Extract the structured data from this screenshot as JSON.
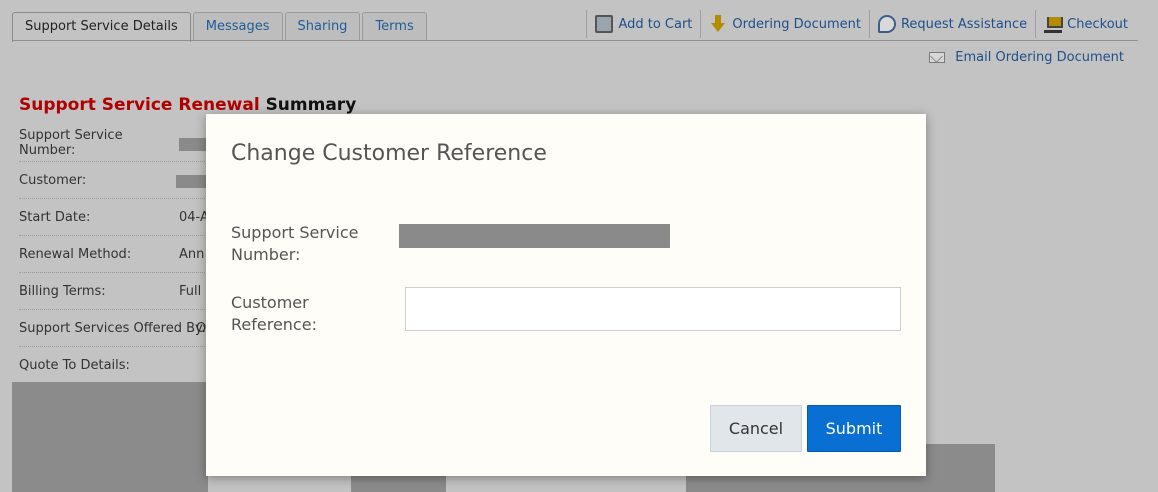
{
  "tabs": [
    {
      "label": "Support Service Details",
      "active": true
    },
    {
      "label": "Messages",
      "active": false
    },
    {
      "label": "Sharing",
      "active": false
    },
    {
      "label": "Terms",
      "active": false
    }
  ],
  "toolbar": {
    "add_to_cart": "Add to Cart",
    "ordering_document": "Ordering Document",
    "request_assistance": "Request Assistance",
    "checkout": "Checkout",
    "email_ordering_document": "Email Ordering Document"
  },
  "summary": {
    "title_red": "Support Service Renewal",
    "title_black": "Summary",
    "rows": [
      {
        "label": "Support Service Number:",
        "value": ""
      },
      {
        "label": "Customer:",
        "value": ""
      },
      {
        "label": "Start Date:",
        "value": "04-A"
      },
      {
        "label": "Renewal Method:",
        "value": "Ann"
      },
      {
        "label": "Billing Terms:",
        "value": "Full i"
      },
      {
        "label": "Support Services Offered By:",
        "value": "O"
      },
      {
        "label": "Quote To Details:",
        "value": ""
      }
    ]
  },
  "modal": {
    "title": "Change Customer Reference",
    "support_service_number_label": "Support Service Number:",
    "customer_reference_label": "Customer Reference:",
    "customer_reference_value": "",
    "cancel_label": "Cancel",
    "submit_label": "Submit"
  },
  "colors": {
    "accent_red": "#b00000",
    "link_blue": "#1f4f8a",
    "submit_blue": "#0a6fd3"
  }
}
